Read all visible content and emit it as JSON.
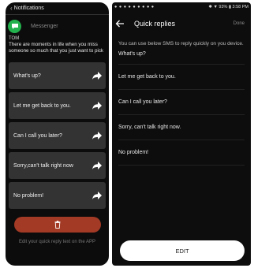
{
  "watch": {
    "header": "Notifications",
    "app_name": "Messenger",
    "sender": "TOM",
    "message": "There are moments in life when you miss someone so much that you just want to pick",
    "replies": [
      {
        "label": "What's up?"
      },
      {
        "label": "Let me get back to you."
      },
      {
        "label": "Can I call you later?"
      },
      {
        "label": "Sorry,can't talk right now"
      },
      {
        "label": "No problem!"
      }
    ],
    "footer": "Edit your quick reply text on the APP"
  },
  "phone": {
    "status": {
      "dots": "● ● ● ● ● ● ● ● ●",
      "right": "✱ ▼ 93% ▮ 3:58 PM"
    },
    "title": "Quick replies",
    "done_label": "Done",
    "description": "You can use below SMS to reply quickly on you device.",
    "replies": [
      {
        "label": "What's up?"
      },
      {
        "label": "Let me get back to you."
      },
      {
        "label": "Can I call you later?"
      },
      {
        "label": "Sorry, can't talk right now."
      },
      {
        "label": "No problem!"
      }
    ],
    "edit_label": "EDIT"
  },
  "colors": {
    "accent_green": "#23b14d",
    "delete_red": "#a33a25",
    "tile": "#333333"
  }
}
